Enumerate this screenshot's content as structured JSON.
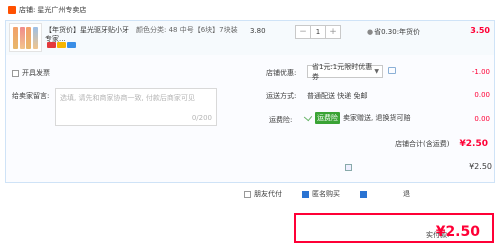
{
  "shop": {
    "prefix": "店铺:",
    "name": "星光广州专卖店"
  },
  "item": {
    "title": "【年货价】星光驱牙贴小牙专家...",
    "sku": "颜色分类: 48 中号【6块】7块装",
    "unit_price": "3.80",
    "quantity": "1",
    "minus": "−",
    "plus": "+",
    "discount_note": "省0.30:年货价",
    "subtotal": "3.50",
    "badge_colors": [
      "#e4393c",
      "#f7b500",
      "#3a8ee6"
    ]
  },
  "invoice": {
    "label": "开具发票"
  },
  "note": {
    "label": "给卖家留言:",
    "placeholder": "选填, 请先和商家协商一致, 付款后商家可见",
    "counter": "0/200"
  },
  "coupon": {
    "label": "店铺优惠:",
    "selected": "省1元:1元限时优惠券",
    "amount": "-1.00"
  },
  "shipping": {
    "label": "运送方式:",
    "value": "普通配送 快递 免邮",
    "amount": "0.00"
  },
  "insurance": {
    "label": "运费险:",
    "tag": "运费险",
    "text": "卖家赠送, 退换货可赔",
    "amount": "0.00"
  },
  "shop_total": {
    "label": "店铺合计(含运费)",
    "amount": "¥2.50"
  },
  "bottom": {
    "amount_right": "¥2.50",
    "opt1": "朋友代付",
    "opt2": "匿名购买",
    "opt3_prefix": "退"
  },
  "pay": {
    "label": "实付款:",
    "amount": "¥2.50"
  }
}
